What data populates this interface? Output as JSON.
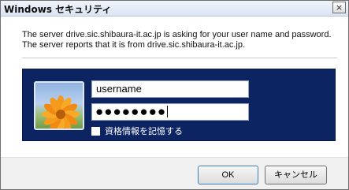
{
  "window": {
    "title": "Windows セキュリティ",
    "close_label": "×"
  },
  "message": "The server drive.sic.shibaura-it.ac.jp is asking for your user name and password. The server reports that it is from drive.sic.shibaura-it.ac.jp.",
  "credentials": {
    "username_value": "username",
    "password_value": "●●●●●●●●",
    "remember_label": "資格情報を記憶する",
    "remember_checked": false
  },
  "buttons": {
    "ok_label": "OK",
    "cancel_label": "キャンセル"
  },
  "colors": {
    "panel_background": "#0d2462",
    "footer_background": "#f0f0f0"
  },
  "icons": {
    "avatar": "flower-user-tile-icon",
    "close": "close-icon"
  }
}
